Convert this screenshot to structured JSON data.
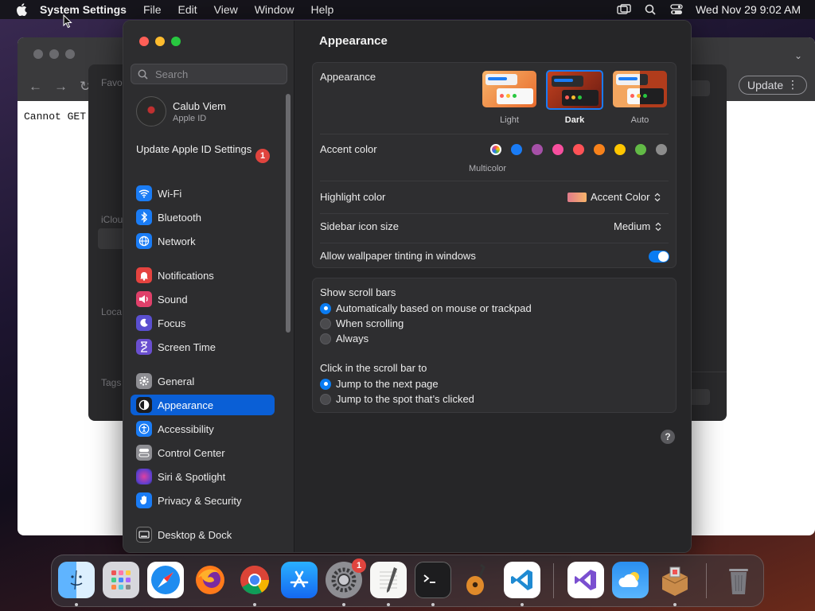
{
  "menubar": {
    "app_name": "System Settings",
    "items": [
      "File",
      "Edit",
      "View",
      "Window",
      "Help"
    ],
    "clock": "Wed Nov 29  9:02 AM"
  },
  "browser": {
    "update_label": "Update",
    "page_text": "Cannot GET"
  },
  "finder": {
    "labels": [
      "Favo",
      "iClou",
      "Loca",
      "Tags"
    ]
  },
  "settings": {
    "search_placeholder": "Search",
    "profile": {
      "name": "Calub Viem",
      "sub": "Apple ID"
    },
    "update_apple_id": "Update Apple ID Settings",
    "update_badge": "1",
    "sidebar": [
      {
        "label": "Wi-Fi",
        "icon": "wifi-icon",
        "color": "#1a7cf5"
      },
      {
        "label": "Bluetooth",
        "icon": "bluetooth-icon",
        "color": "#1a7cf5"
      },
      {
        "label": "Network",
        "icon": "globe-icon",
        "color": "#1a7cf5"
      },
      {
        "label": "Notifications",
        "icon": "bell-icon",
        "color": "#e5433f"
      },
      {
        "label": "Sound",
        "icon": "speaker-icon",
        "color": "#e0406a"
      },
      {
        "label": "Focus",
        "icon": "moon-icon",
        "color": "#5a4fd0"
      },
      {
        "label": "Screen Time",
        "icon": "hourglass-icon",
        "color": "#6a4fd0"
      },
      {
        "label": "General",
        "icon": "gear-icon",
        "color": "#8e8e93"
      },
      {
        "label": "Appearance",
        "icon": "appearance-icon",
        "color": "#1c1c1e"
      },
      {
        "label": "Accessibility",
        "icon": "accessibility-icon",
        "color": "#1a7cf5"
      },
      {
        "label": "Control Center",
        "icon": "control-center-icon",
        "color": "#8e8e93"
      },
      {
        "label": "Siri & Spotlight",
        "icon": "siri-icon",
        "color": "#7a3fd0"
      },
      {
        "label": "Privacy & Security",
        "icon": "hand-icon",
        "color": "#1a7cf5"
      },
      {
        "label": "Desktop & Dock",
        "icon": "desktop-icon",
        "color": "#2a2a2c"
      }
    ],
    "selected": "Appearance",
    "content_title": "Appearance",
    "appearance": {
      "label": "Appearance",
      "options": [
        "Light",
        "Dark",
        "Auto"
      ],
      "selected": "Dark"
    },
    "accent": {
      "label": "Accent color",
      "caption": "Multicolor",
      "colors": [
        "multicolor",
        "#1a7cf5",
        "#a550a7",
        "#f74f9e",
        "#ff5257",
        "#f7821b",
        "#ffc600",
        "#62ba46",
        "#8c8c8c"
      ]
    },
    "highlight": {
      "label": "Highlight color",
      "value": "Accent Color"
    },
    "sidebar_icon": {
      "label": "Sidebar icon size",
      "value": "Medium"
    },
    "wallpaper_tint": {
      "label": "Allow wallpaper tinting in windows",
      "on": true
    },
    "scroll_bars": {
      "label": "Show scroll bars",
      "options": [
        "Automatically based on mouse or trackpad",
        "When scrolling",
        "Always"
      ],
      "selected": 0
    },
    "click_scroll": {
      "label": "Click in the scroll bar to",
      "options": [
        "Jump to the next page",
        "Jump to the spot that’s clicked"
      ],
      "selected": 0
    },
    "help": "?"
  },
  "dock": {
    "apps": [
      "Finder",
      "Launchpad",
      "Safari",
      "Firefox",
      "Chrome",
      "App Store",
      "System Settings",
      "TextEdit",
      "Terminal",
      "GarageBand",
      "Visual Studio Code",
      "Visual Studio",
      "Weather",
      "Archive Utility",
      "Trash"
    ],
    "settings_badge": "1"
  }
}
